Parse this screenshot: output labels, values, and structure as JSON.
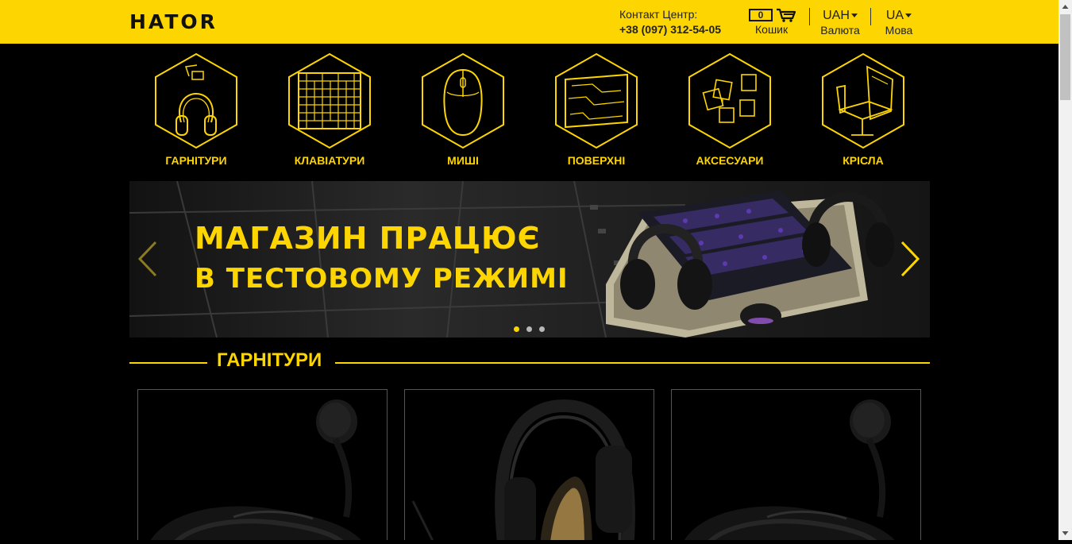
{
  "header": {
    "logo": "HATOR",
    "contact_label": "Контакт Центр:",
    "phone": "+38 (097) 312-54-05",
    "cart_count": "0",
    "cart_label": "Кошик",
    "currency_value": "UAH",
    "currency_label": "Валюта",
    "language_value": "UA",
    "language_label": "Мова",
    "icons": [
      "cart-icon",
      "chevron-down-icon"
    ],
    "accent_color": "#fdd500"
  },
  "categories": [
    {
      "label": "ГАРНІТУРИ",
      "icon": "headset-icon"
    },
    {
      "label": "КЛАВІАТУРИ",
      "icon": "keyboard-icon"
    },
    {
      "label": "МИШІ",
      "icon": "mouse-icon"
    },
    {
      "label": "ПОВЕРХНІ",
      "icon": "mousepad-icon"
    },
    {
      "label": "АКСЕСУАРИ",
      "icon": "accessories-icon"
    },
    {
      "label": "КРІСЛА",
      "icon": "chair-icon"
    }
  ],
  "banner": {
    "line1": "МАГАЗИН ПРАЦЮЄ",
    "line2": "В ТЕСТОВОМУ РЕЖИМІ",
    "slide_count": 3,
    "active_slide": 1
  },
  "section": {
    "title": "ГАРНІТУРИ"
  },
  "products": [
    {
      "image": "headset-with-mic-image"
    },
    {
      "image": "headset-wood-image"
    },
    {
      "image": "headset-with-mic-image"
    }
  ]
}
